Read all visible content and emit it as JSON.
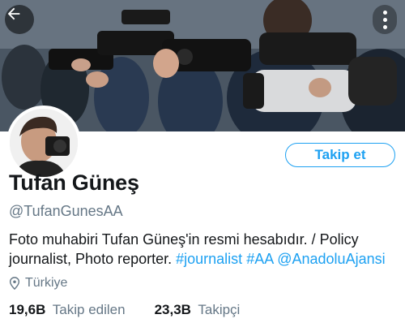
{
  "header": {
    "back_icon": "arrow-left-icon",
    "more_icon": "vertical-dots-icon"
  },
  "profile": {
    "follow_label": "Takip et",
    "name": "Tufan Güneş",
    "handle": "@TufanGunesAA",
    "bio_text": "Foto muhabiri Tufan Güneş'in resmi hesabıdır. /  Policy journalist, Photo reporter. ",
    "bio_links": [
      "#journalist",
      "#AA",
      "@AnadoluAjansi"
    ],
    "location": "Türkiye",
    "location_icon": "location-pin-icon",
    "following_count": "19,6B",
    "following_label": "Takip edilen",
    "followers_count": "23,3B",
    "followers_label": "Takipçi"
  },
  "colors": {
    "accent": "#1da1f2",
    "secondary_text": "#657786",
    "primary_text": "#14171a"
  }
}
